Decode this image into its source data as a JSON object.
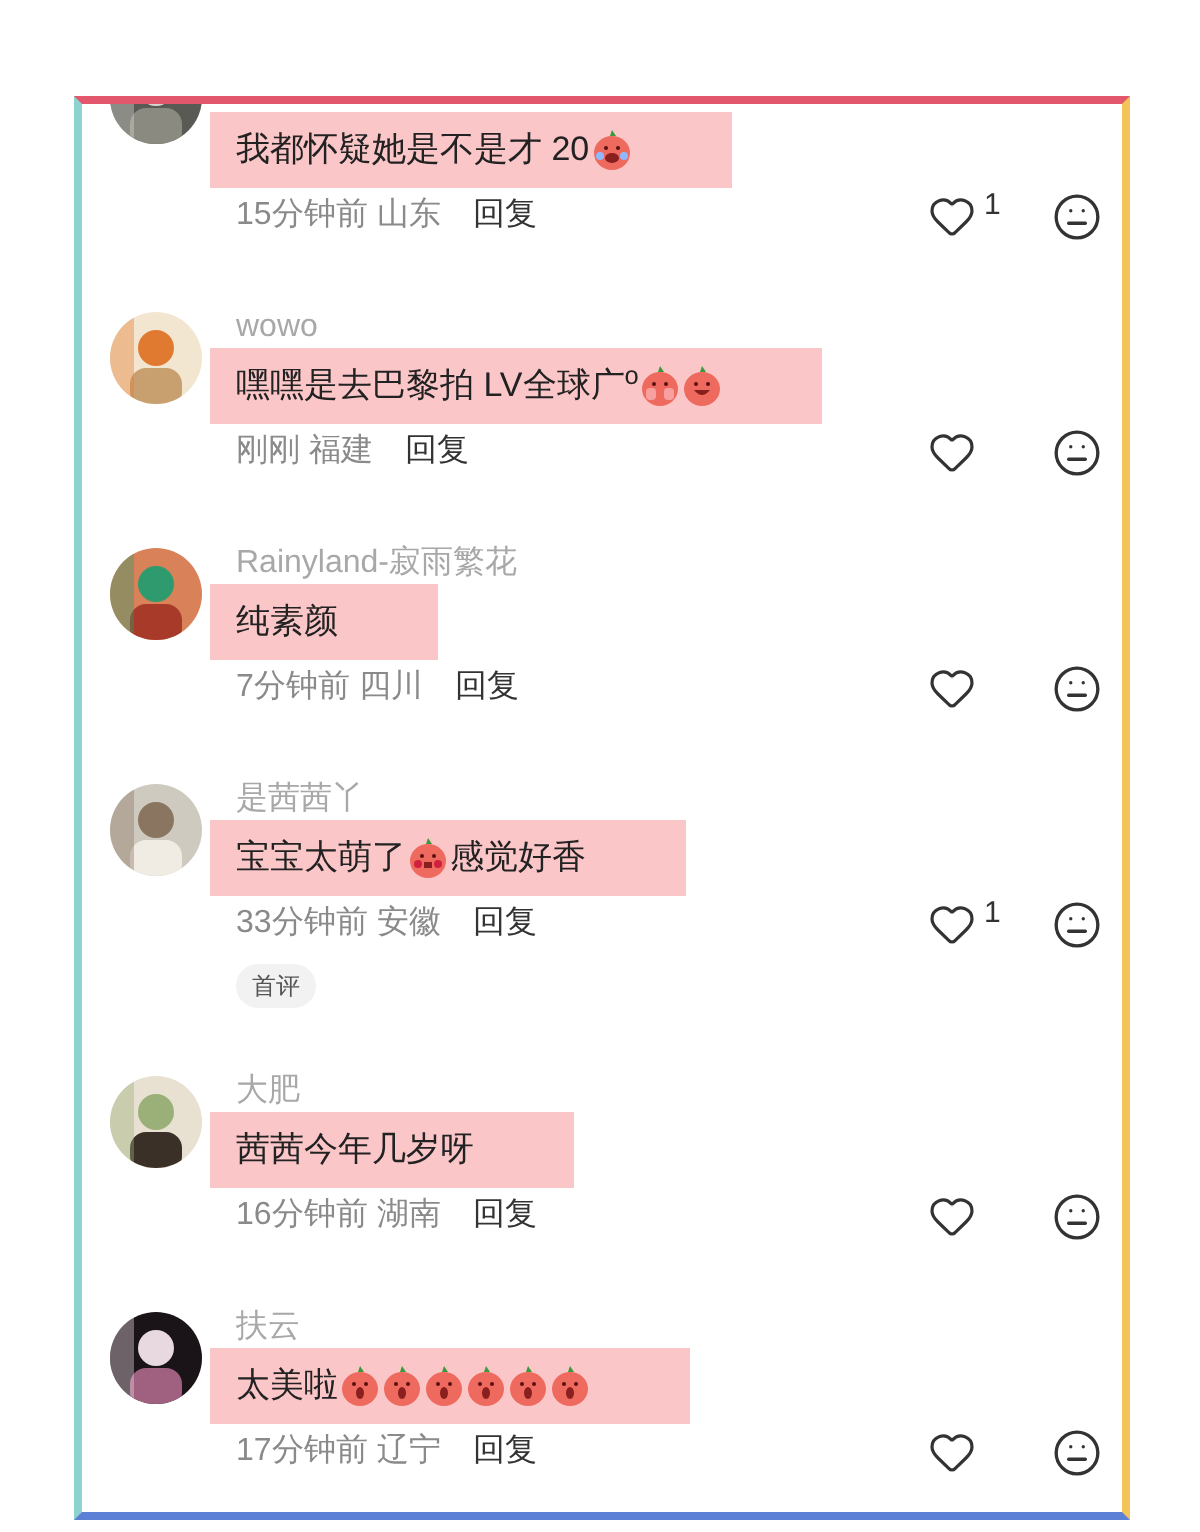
{
  "comments": [
    {
      "text": "我都怀疑她是不是才 20",
      "stickers": [
        {
          "kind": "crying"
        }
      ],
      "time": "15分钟前",
      "region": "山东",
      "reply": "回复",
      "likes": "1"
    },
    {
      "name": "wowo",
      "text": "嘿嘿是去巴黎拍 LV全球广$^{o}$",
      "stickers": [
        {
          "kind": "covering"
        },
        {
          "kind": "laughing"
        }
      ],
      "time": "刚刚",
      "region": "福建",
      "reply": "回复"
    },
    {
      "name": "Rainyland-寂雨繁花",
      "text": "纯素颜",
      "time": "7分钟前",
      "region": "四川",
      "reply": "回复"
    },
    {
      "name": "是茜茜丫",
      "text": "宝宝太萌了",
      "stickers": [
        {
          "kind": "blush"
        }
      ],
      "after": "感觉好香",
      "time": "33分钟前",
      "region": "安徽",
      "reply": "回复",
      "likes": "1",
      "badge": "首评"
    },
    {
      "name": "大肥",
      "text": "茜茜今年几岁呀",
      "time": "16分钟前",
      "region": "湖南",
      "reply": "回复"
    },
    {
      "name": "扶云",
      "text": "太美啦",
      "stickers": [
        {
          "kind": "shock"
        },
        {
          "kind": "shock"
        },
        {
          "kind": "shock"
        },
        {
          "kind": "shock"
        },
        {
          "kind": "shock"
        },
        {
          "kind": "shock"
        }
      ],
      "time": "17分钟前",
      "region": "辽宁",
      "reply": "回复"
    }
  ]
}
